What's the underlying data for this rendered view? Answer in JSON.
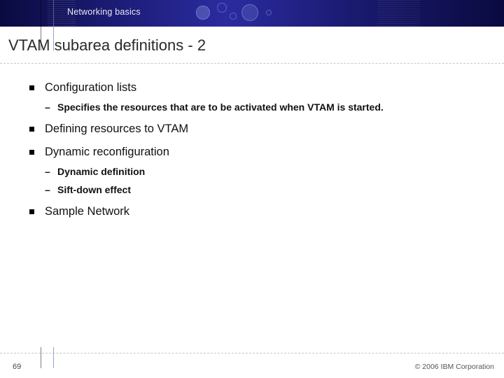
{
  "header": {
    "breadcrumb": "Networking basics"
  },
  "title": "VTAM subarea definitions - 2",
  "bullets": [
    {
      "text": "Configuration lists",
      "sub": [
        "Specifies the resources that are to be activated when VTAM is started."
      ]
    },
    {
      "text": "Defining resources to VTAM",
      "sub": []
    },
    {
      "text": "Dynamic reconfiguration",
      "sub": [
        "Dynamic definition",
        "Sift-down effect"
      ]
    },
    {
      "text": "Sample Network",
      "sub": []
    }
  ],
  "footer": {
    "page_number": "69",
    "copyright": "© 2006 IBM Corporation"
  }
}
